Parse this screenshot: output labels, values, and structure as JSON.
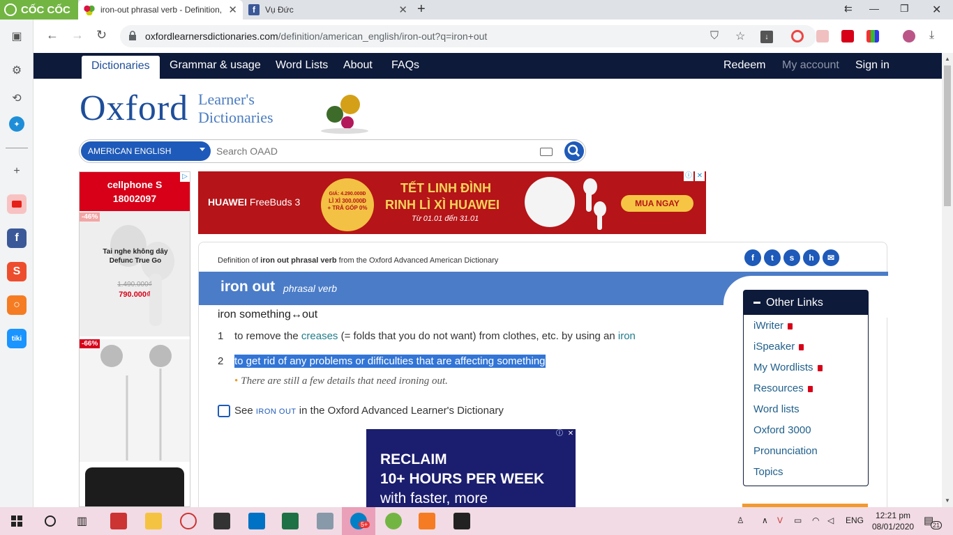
{
  "browser": {
    "brand": "CỐC CỐC",
    "tabs": [
      {
        "title": "iron-out phrasal verb - Definition,",
        "active": true
      },
      {
        "title": "Vụ Đức",
        "active": false
      }
    ],
    "url_domain": "oxfordlearnersdictionaries.com",
    "url_path": "/definition/american_english/iron-out?q=iron+out"
  },
  "site_nav": {
    "left": [
      "Dictionaries",
      "Grammar & usage",
      "Word Lists",
      "About",
      "FAQs"
    ],
    "right": [
      "Redeem",
      "My account",
      "Sign in"
    ]
  },
  "logo": {
    "oxford": "Oxford",
    "line1": "Learner's",
    "line2": "Dictionaries"
  },
  "search": {
    "language": "AMERICAN ENGLISH",
    "placeholder": "Search OAAD"
  },
  "ad_left": {
    "brand": "cellphone S",
    "phone": "18002097",
    "badge1": "-46%",
    "product": "Tai nghe không dây Defunc True Go",
    "old_price": "1.490.000₫",
    "new_price": "790.000₫",
    "badge2": "-66%"
  },
  "ad_top": {
    "brand_bold": "HUAWEI",
    "brand_rest": " FreeBuds 3",
    "coin_line1": "GIÁ: 4.290.000Đ",
    "coin_line2": "LÌ XÌ 300.000Đ",
    "coin_line3": "+ TRẢ GÓP 0%",
    "headline1": "TẾT LINH ĐÌNH",
    "headline2": "RINH LÌ XÌ HUAWEI",
    "dates": "Từ 01.01 đến 31.01",
    "cta": "MUA NGAY"
  },
  "entry": {
    "def_of_prefix": "Definition of ",
    "def_of_bold": "iron out phrasal verb",
    "def_of_suffix": " from the Oxford Advanced American Dictionary",
    "headword": "iron out",
    "pos": "phrasal verb",
    "pattern": "iron something↔out",
    "sense1": {
      "num": "1",
      "pre": "to remove the ",
      "link1": "creases",
      "mid": " (= folds that you do not want) from clothes, etc. by using an ",
      "link2": "iron"
    },
    "sense2": {
      "num": "2",
      "text": "to get rid of any problems or difficulties that are affecting something"
    },
    "example": "There are still a few details that need ironing out.",
    "see_pre": "See ",
    "see_link": "iron out",
    "see_post": " in the Oxford Advanced Learner's Dictionary"
  },
  "ad_bottom": {
    "line1": "RECLAIM",
    "line2": "10+ HOURS PER WEEK",
    "line3": "with faster, more"
  },
  "other_links": {
    "title": "Other Links",
    "items": [
      "iWriter",
      "iSpeaker",
      "My Wordlists",
      "Resources",
      "Word lists",
      "Oxford 3000",
      "Pronunciation",
      "Topics"
    ]
  },
  "taskbar": {
    "lang": "ENG",
    "time": "12:21 pm",
    "date": "08/01/2020",
    "notifications": "21",
    "badge": "5+"
  },
  "colors": {
    "oxford_navy": "#0d1a3a",
    "oxford_blue": "#1e5ab9",
    "headword_bar": "#4b7cc8",
    "selection": "#3275d6",
    "coccoc_green": "#73b543"
  }
}
